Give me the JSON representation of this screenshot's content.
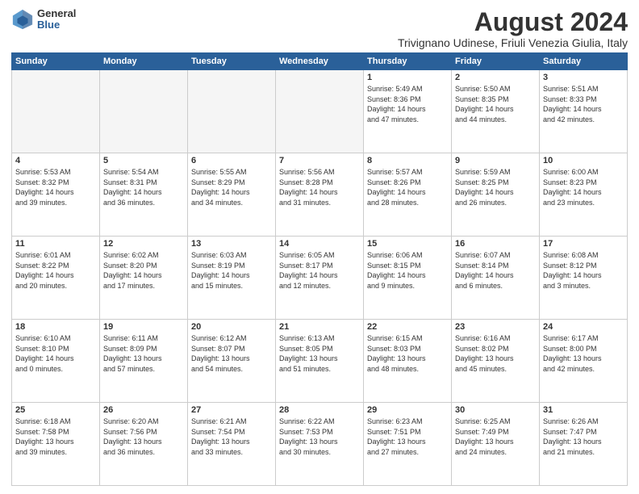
{
  "logo": {
    "general": "General",
    "blue": "Blue"
  },
  "title": "August 2024",
  "location": "Trivignano Udinese, Friuli Venezia Giulia, Italy",
  "weekdays": [
    "Sunday",
    "Monday",
    "Tuesday",
    "Wednesday",
    "Thursday",
    "Friday",
    "Saturday"
  ],
  "weeks": [
    [
      {
        "day": "",
        "info": ""
      },
      {
        "day": "",
        "info": ""
      },
      {
        "day": "",
        "info": ""
      },
      {
        "day": "",
        "info": ""
      },
      {
        "day": "1",
        "info": "Sunrise: 5:49 AM\nSunset: 8:36 PM\nDaylight: 14 hours\nand 47 minutes."
      },
      {
        "day": "2",
        "info": "Sunrise: 5:50 AM\nSunset: 8:35 PM\nDaylight: 14 hours\nand 44 minutes."
      },
      {
        "day": "3",
        "info": "Sunrise: 5:51 AM\nSunset: 8:33 PM\nDaylight: 14 hours\nand 42 minutes."
      }
    ],
    [
      {
        "day": "4",
        "info": "Sunrise: 5:53 AM\nSunset: 8:32 PM\nDaylight: 14 hours\nand 39 minutes."
      },
      {
        "day": "5",
        "info": "Sunrise: 5:54 AM\nSunset: 8:31 PM\nDaylight: 14 hours\nand 36 minutes."
      },
      {
        "day": "6",
        "info": "Sunrise: 5:55 AM\nSunset: 8:29 PM\nDaylight: 14 hours\nand 34 minutes."
      },
      {
        "day": "7",
        "info": "Sunrise: 5:56 AM\nSunset: 8:28 PM\nDaylight: 14 hours\nand 31 minutes."
      },
      {
        "day": "8",
        "info": "Sunrise: 5:57 AM\nSunset: 8:26 PM\nDaylight: 14 hours\nand 28 minutes."
      },
      {
        "day": "9",
        "info": "Sunrise: 5:59 AM\nSunset: 8:25 PM\nDaylight: 14 hours\nand 26 minutes."
      },
      {
        "day": "10",
        "info": "Sunrise: 6:00 AM\nSunset: 8:23 PM\nDaylight: 14 hours\nand 23 minutes."
      }
    ],
    [
      {
        "day": "11",
        "info": "Sunrise: 6:01 AM\nSunset: 8:22 PM\nDaylight: 14 hours\nand 20 minutes."
      },
      {
        "day": "12",
        "info": "Sunrise: 6:02 AM\nSunset: 8:20 PM\nDaylight: 14 hours\nand 17 minutes."
      },
      {
        "day": "13",
        "info": "Sunrise: 6:03 AM\nSunset: 8:19 PM\nDaylight: 14 hours\nand 15 minutes."
      },
      {
        "day": "14",
        "info": "Sunrise: 6:05 AM\nSunset: 8:17 PM\nDaylight: 14 hours\nand 12 minutes."
      },
      {
        "day": "15",
        "info": "Sunrise: 6:06 AM\nSunset: 8:15 PM\nDaylight: 14 hours\nand 9 minutes."
      },
      {
        "day": "16",
        "info": "Sunrise: 6:07 AM\nSunset: 8:14 PM\nDaylight: 14 hours\nand 6 minutes."
      },
      {
        "day": "17",
        "info": "Sunrise: 6:08 AM\nSunset: 8:12 PM\nDaylight: 14 hours\nand 3 minutes."
      }
    ],
    [
      {
        "day": "18",
        "info": "Sunrise: 6:10 AM\nSunset: 8:10 PM\nDaylight: 14 hours\nand 0 minutes."
      },
      {
        "day": "19",
        "info": "Sunrise: 6:11 AM\nSunset: 8:09 PM\nDaylight: 13 hours\nand 57 minutes."
      },
      {
        "day": "20",
        "info": "Sunrise: 6:12 AM\nSunset: 8:07 PM\nDaylight: 13 hours\nand 54 minutes."
      },
      {
        "day": "21",
        "info": "Sunrise: 6:13 AM\nSunset: 8:05 PM\nDaylight: 13 hours\nand 51 minutes."
      },
      {
        "day": "22",
        "info": "Sunrise: 6:15 AM\nSunset: 8:03 PM\nDaylight: 13 hours\nand 48 minutes."
      },
      {
        "day": "23",
        "info": "Sunrise: 6:16 AM\nSunset: 8:02 PM\nDaylight: 13 hours\nand 45 minutes."
      },
      {
        "day": "24",
        "info": "Sunrise: 6:17 AM\nSunset: 8:00 PM\nDaylight: 13 hours\nand 42 minutes."
      }
    ],
    [
      {
        "day": "25",
        "info": "Sunrise: 6:18 AM\nSunset: 7:58 PM\nDaylight: 13 hours\nand 39 minutes."
      },
      {
        "day": "26",
        "info": "Sunrise: 6:20 AM\nSunset: 7:56 PM\nDaylight: 13 hours\nand 36 minutes."
      },
      {
        "day": "27",
        "info": "Sunrise: 6:21 AM\nSunset: 7:54 PM\nDaylight: 13 hours\nand 33 minutes."
      },
      {
        "day": "28",
        "info": "Sunrise: 6:22 AM\nSunset: 7:53 PM\nDaylight: 13 hours\nand 30 minutes."
      },
      {
        "day": "29",
        "info": "Sunrise: 6:23 AM\nSunset: 7:51 PM\nDaylight: 13 hours\nand 27 minutes."
      },
      {
        "day": "30",
        "info": "Sunrise: 6:25 AM\nSunset: 7:49 PM\nDaylight: 13 hours\nand 24 minutes."
      },
      {
        "day": "31",
        "info": "Sunrise: 6:26 AM\nSunset: 7:47 PM\nDaylight: 13 hours\nand 21 minutes."
      }
    ]
  ]
}
